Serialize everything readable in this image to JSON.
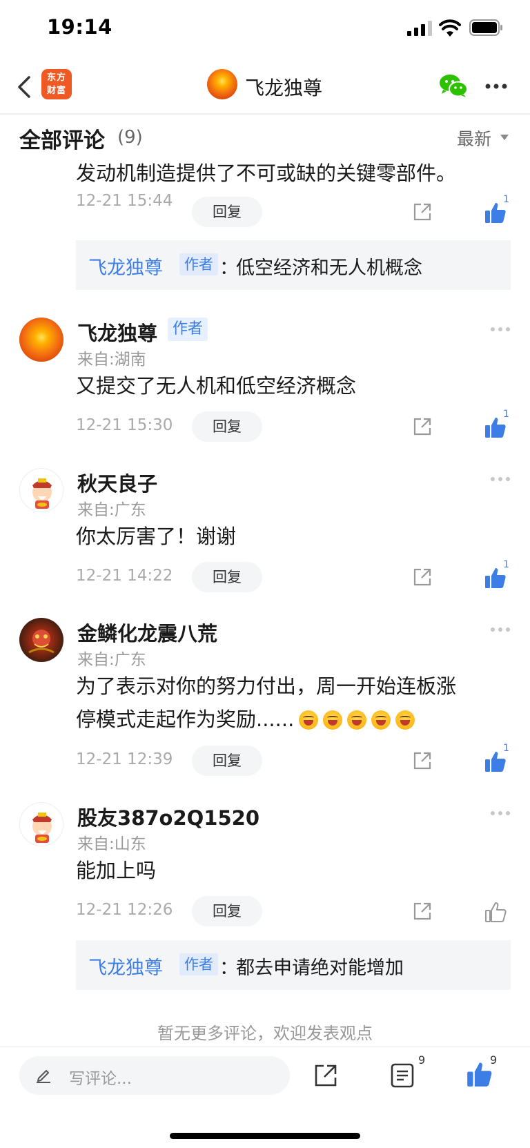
{
  "status_bar": {
    "time": "19:14"
  },
  "nav": {
    "app_logo_top": "东方",
    "app_logo_bottom": "财富",
    "title": "飞龙独尊"
  },
  "comments_header": {
    "title": "全部评论",
    "count": "(9)",
    "sort": "最新"
  },
  "fragment": {
    "text": "发动机制造提供了不可或缺的关键零部件。",
    "time": "12-21 15:44",
    "reply_label": "回复",
    "likes": "1",
    "reply": {
      "user": "飞龙独尊",
      "tag": "作者",
      "colon": "：",
      "text": "低空经济和无人机概念"
    }
  },
  "comments": [
    {
      "user": "飞龙独尊",
      "tag": "作者",
      "location": "来自:湖南",
      "content": "又提交了无人机和低空经济概念",
      "time": "12-21 15:30",
      "reply_label": "回复",
      "likes": "1"
    },
    {
      "user": "秋天良子",
      "location": "来自:广东",
      "content": "你太厉害了！谢谢",
      "time": "12-21 14:22",
      "reply_label": "回复",
      "likes": "1"
    },
    {
      "user": "金鳞化龙震八荒",
      "location": "来自:广东",
      "content_line1": "为了表示对你的努力付出，周一开始连板涨",
      "content_line2": "停模式走起作为奖励......",
      "emoji_name": "laughing-face-icon",
      "time": "12-21 12:39",
      "reply_label": "回复",
      "likes": "1"
    },
    {
      "user": "股友387o2Q1520",
      "location": "来自:山东",
      "content": "能加上吗",
      "time": "12-21 12:26",
      "reply_label": "回复",
      "reply": {
        "user": "飞龙独尊",
        "tag": "作者",
        "colon": "：",
        "text": "都去申请绝对能增加"
      }
    }
  ],
  "end_hint": "暂无更多评论，欢迎发表观点",
  "bottom_bar": {
    "input_placeholder": "写评论...",
    "list_count": "9",
    "like_count": "9"
  },
  "colors": {
    "accent": "#3d7ee6",
    "brand": "#ef5a24",
    "wechat": "#2dc100"
  }
}
